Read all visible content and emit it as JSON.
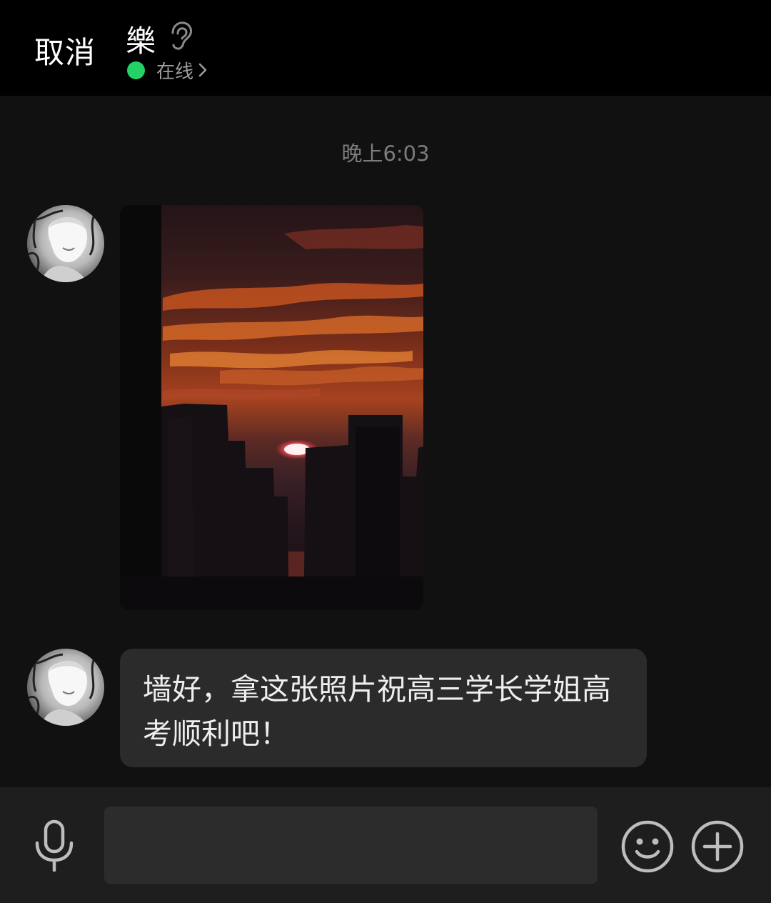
{
  "header": {
    "cancel_label": "取消",
    "contact_name": "樂",
    "status_text": "在线",
    "status_color": "#24d166"
  },
  "chat": {
    "timestamp": "晚上6:03",
    "messages": [
      {
        "type": "image",
        "sender": "other",
        "image": "sunset-city-skyline-photo"
      },
      {
        "type": "text",
        "sender": "other",
        "text": "墙好，拿这张照片祝高三学长学姐高考顺利吧！"
      }
    ]
  },
  "input_bar": {
    "value": "",
    "left_icon": "voice-mic-icon",
    "right_icons": [
      "emoji-icon",
      "plus-icon"
    ]
  }
}
